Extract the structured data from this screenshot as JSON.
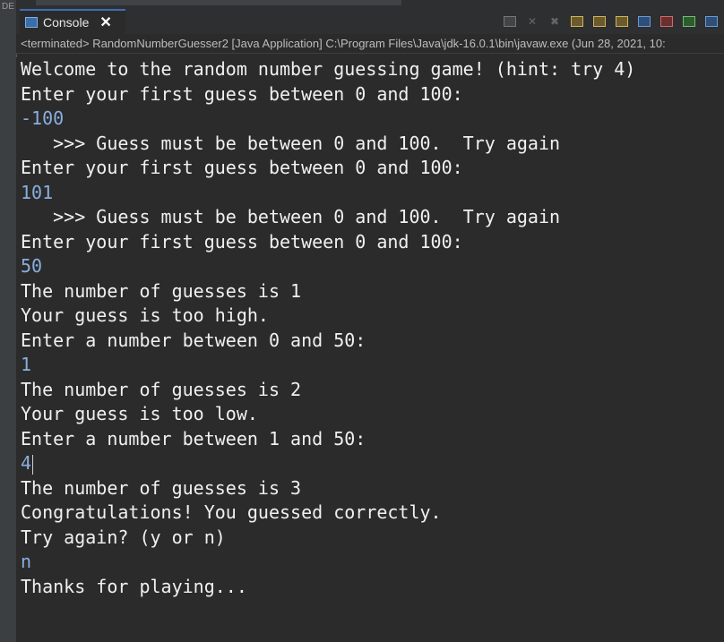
{
  "app": {
    "left_strip_label": "DE",
    "tab_label": "Console",
    "tab_close": "✕"
  },
  "toolbar": {
    "icons": [
      "terminate-icon",
      "remove-launch-icon",
      "remove-all-icon",
      "scroll-lock-icon",
      "word-wrap-icon",
      "show-on-output-icon",
      "pin-console-icon",
      "display-selected-console-icon",
      "open-console-icon",
      "new-console-icon"
    ]
  },
  "status": {
    "text": "<terminated> RandomNumberGuesser2 [Java Application] C:\\Program Files\\Java\\jdk-16.0.1\\bin\\javaw.exe  (Jun 28, 2021, 10:"
  },
  "console": {
    "lines": [
      {
        "text": "Welcome to the random number guessing game! (hint: try 4)",
        "kind": "out"
      },
      {
        "text": "Enter your first guess between 0 and 100:",
        "kind": "out"
      },
      {
        "text": "-100",
        "kind": "in"
      },
      {
        "text": "   >>> Guess must be between 0 and 100.  Try again",
        "kind": "out"
      },
      {
        "text": "Enter your first guess between 0 and 100:",
        "kind": "out"
      },
      {
        "text": "101",
        "kind": "in"
      },
      {
        "text": "   >>> Guess must be between 0 and 100.  Try again",
        "kind": "out"
      },
      {
        "text": "Enter your first guess between 0 and 100:",
        "kind": "out"
      },
      {
        "text": "50",
        "kind": "in"
      },
      {
        "text": "The number of guesses is 1",
        "kind": "out"
      },
      {
        "text": "Your guess is too high.",
        "kind": "out"
      },
      {
        "text": "Enter a number between 0 and 50:",
        "kind": "out"
      },
      {
        "text": "1",
        "kind": "in"
      },
      {
        "text": "The number of guesses is 2",
        "kind": "out"
      },
      {
        "text": "Your guess is too low.",
        "kind": "out"
      },
      {
        "text": "Enter a number between 1 and 50:",
        "kind": "out"
      },
      {
        "text": "4",
        "kind": "in"
      },
      {
        "text": "The number of guesses is 3",
        "kind": "out"
      },
      {
        "text": "Congratulations! You guessed correctly.",
        "kind": "out"
      },
      {
        "text": "Try again? (y or n)",
        "kind": "out"
      },
      {
        "text": "n",
        "kind": "in"
      },
      {
        "text": "Thanks for playing...",
        "kind": "out"
      }
    ]
  },
  "colors": {
    "output": "#f0f0f0",
    "input": "#8aaee0",
    "background": "#2b2b2b"
  }
}
